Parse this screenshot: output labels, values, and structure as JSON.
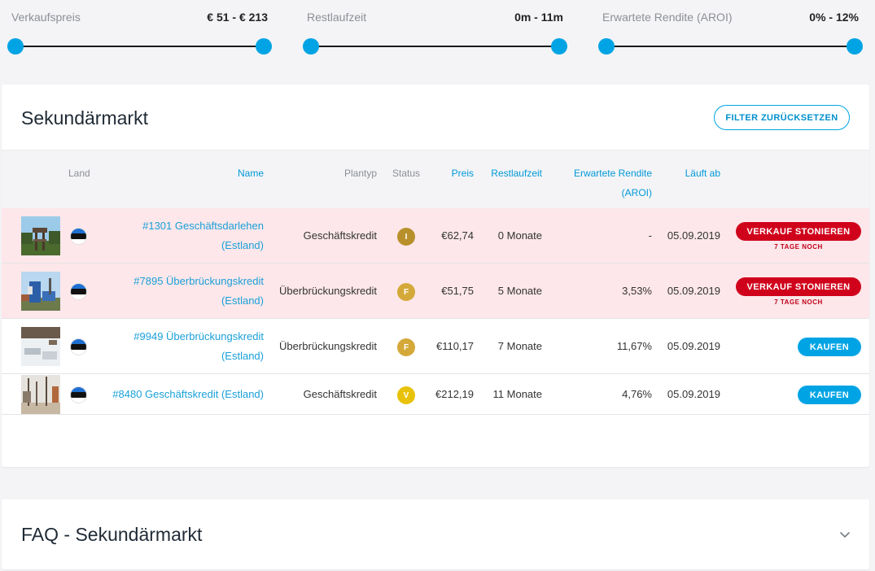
{
  "filters": [
    {
      "label": "Verkaufspreis",
      "value": "€ 51 - € 213"
    },
    {
      "label": "Restlaufzeit",
      "value": "0m - 11m"
    },
    {
      "label": "Erwartete Rendite (AROI)",
      "value": "0% - 12%"
    }
  ],
  "market": {
    "title": "Sekundärmarkt",
    "reset_label": "FILTER ZURÜCKSETZEN",
    "columns": {
      "land": "Land",
      "name": "Name",
      "plantyp": "Plantyp",
      "status": "Status",
      "preis": "Preis",
      "restlaufzeit": "Restlaufzeit",
      "rendite_line1": "Erwartete Rendite",
      "rendite_line2": "(AROI)",
      "laeuft_ab": "Läuft ab"
    },
    "rows": [
      {
        "name_line1": "#1301 Geschäftsdarlehen",
        "name_line2": "(Estland)",
        "plantyp": "Geschäftskredit",
        "status": "I",
        "preis": "€62,74",
        "restlaufzeit": "0 Monate",
        "rendite": "-",
        "laeuft_ab": "05.09.2019",
        "action": "VERKAUF STONIEREN",
        "note": "7 TAGE NOCH"
      },
      {
        "name_line1": "#7895 Überbrückungskredit",
        "name_line2": "(Estland)",
        "plantyp": "Überbrückungskredit",
        "status": "F",
        "preis": "€51,75",
        "restlaufzeit": "5 Monate",
        "rendite": "3,53%",
        "laeuft_ab": "05.09.2019",
        "action": "VERKAUF STONIEREN",
        "note": "7 TAGE NOCH"
      },
      {
        "name_line1": "#9949 Überbrückungskredit",
        "name_line2": "(Estland)",
        "plantyp": "Überbrückungskredit",
        "status": "F",
        "preis": "€110,17",
        "restlaufzeit": "7 Monate",
        "rendite": "11,67%",
        "laeuft_ab": "05.09.2019",
        "action": "KAUFEN"
      },
      {
        "name_line1": "#8480 Geschäftskredit (Estland)",
        "plantyp": "Geschäftskredit",
        "status": "V",
        "preis": "€212,19",
        "restlaufzeit": "11 Monate",
        "rendite": "4,76%",
        "laeuft_ab": "05.09.2019",
        "action": "KAUFEN"
      }
    ]
  },
  "faq": {
    "title": "FAQ - Sekundärmarkt"
  },
  "colors": {
    "accent": "#00a4e4",
    "danger": "#d0021b",
    "pending_row": "#fde7ea",
    "status_I": "#b8902b",
    "status_F": "#d4a93a",
    "status_V": "#e8c20a"
  },
  "icons": {
    "flag": "estonia-flag-icon",
    "status": "status-badge-icon",
    "faq_toggle": "chevron-down-icon"
  }
}
